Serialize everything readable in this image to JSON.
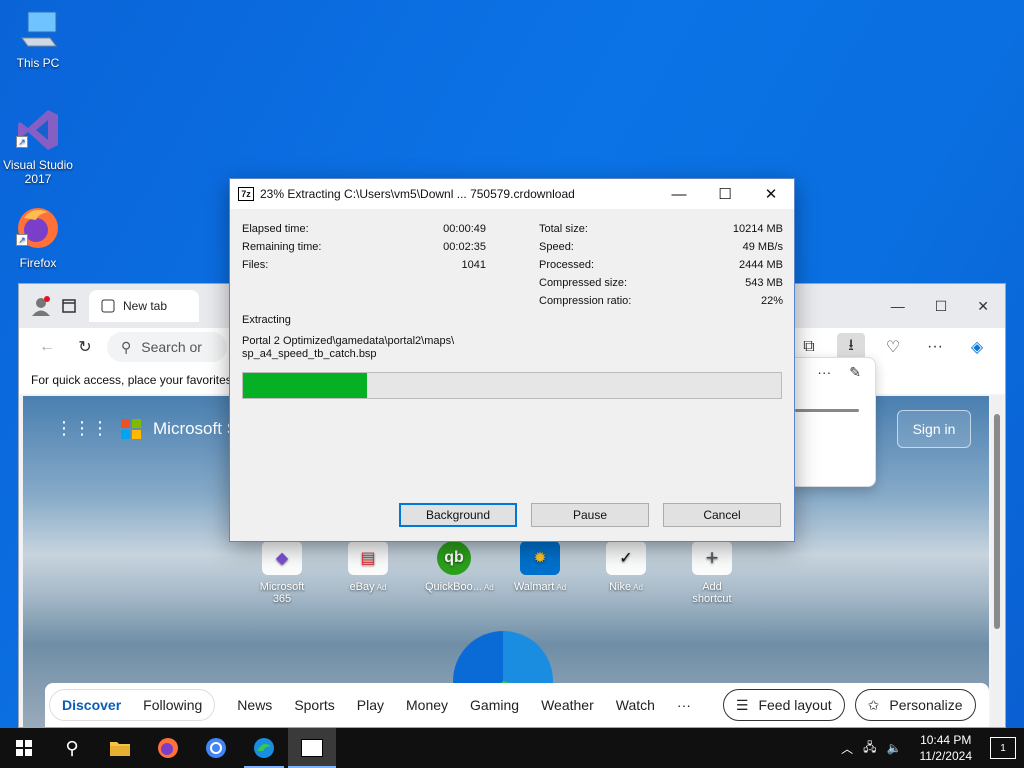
{
  "desktop": {
    "icons": [
      {
        "label": "This PC"
      },
      {
        "label": "Visual Studio 2017"
      },
      {
        "label": "Firefox"
      }
    ]
  },
  "browser": {
    "tab_label": "New tab",
    "address_placeholder": "Search or",
    "favorites_hint": "For quick access, place your favorites",
    "brand": "Microsoft Start",
    "signin_label": "Sign in",
    "ad_label": "Ad",
    "shortcuts": [
      {
        "label": "Microsoft 365",
        "ad": false,
        "glyph": "◆",
        "color": "#7b4fd6"
      },
      {
        "label": "eBay",
        "ad": true,
        "glyph": "▤",
        "color": "#e53238"
      },
      {
        "label": "QuickBoo...",
        "ad": true,
        "glyph": "qb",
        "color": "#2ca01c"
      },
      {
        "label": "Walmart",
        "ad": true,
        "glyph": "✹",
        "color": "#0071ce"
      },
      {
        "label": "Nike",
        "ad": true,
        "glyph": "✓",
        "color": "#111111"
      },
      {
        "label": "Add shortcut",
        "ad": false,
        "glyph": "+",
        "color": "#555555"
      }
    ],
    "feed": {
      "discover": "Discover",
      "following": "Following",
      "items": [
        "News",
        "Sports",
        "Play",
        "Money",
        "Gaming",
        "Weather",
        "Watch",
        "···"
      ],
      "feed_layout": "Feed layout",
      "personalize": "Personalize"
    }
  },
  "dialog": {
    "title": "23% Extracting C:\\Users\\vm5\\Downl ...  750579.crdownload",
    "left_stats": [
      {
        "label": "Elapsed time:",
        "value": "00:00:49"
      },
      {
        "label": "Remaining time:",
        "value": "00:02:35"
      },
      {
        "label": "Files:",
        "value": "1041"
      }
    ],
    "right_stats": [
      {
        "label": "Total size:",
        "value": "10214 MB"
      },
      {
        "label": "Speed:",
        "value": "49 MB/s"
      },
      {
        "label": "Processed:",
        "value": "2444 MB"
      },
      {
        "label": "Compressed size:",
        "value": "543 MB"
      },
      {
        "label": "Compression ratio:",
        "value": "22%"
      }
    ],
    "status": "Extracting",
    "path_line1": "Portal 2 Optimized\\gamedata\\portal2\\maps\\",
    "path_line2": "sp_a4_speed_tb_catch.bsp",
    "progress_percent": 23,
    "buttons": {
      "background": "Background",
      "pause": "Pause",
      "cancel": "Cancel"
    }
  },
  "taskbar": {
    "time": "10:44 PM",
    "date": "11/2/2024",
    "notification_count": "1"
  }
}
